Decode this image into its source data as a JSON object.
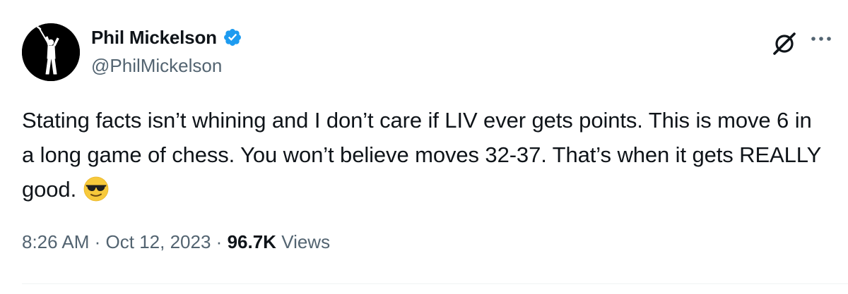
{
  "author": {
    "display_name": "Phil Mickelson",
    "handle": "@PhilMickelson",
    "verified": true,
    "verified_color": "#1d9bf0"
  },
  "tweet": {
    "text": "Stating facts isn’t whining and I don’t care if LIV ever gets points. This is move 6 in a long game of chess. You won’t believe moves 32-37. That’s when it gets REALLY good.",
    "emoji": "smiling-face-with-sunglasses"
  },
  "meta": {
    "time": "8:26 AM",
    "separator": "·",
    "date": "Oct 12, 2023",
    "views_count": "96.7K",
    "views_label": "Views"
  },
  "icons": {
    "grok": "grok-icon",
    "more": "more-options-icon"
  },
  "colors": {
    "text_primary": "#0f1419",
    "text_secondary": "#536471",
    "accent": "#1d9bf0",
    "divider": "#eff3f4"
  }
}
